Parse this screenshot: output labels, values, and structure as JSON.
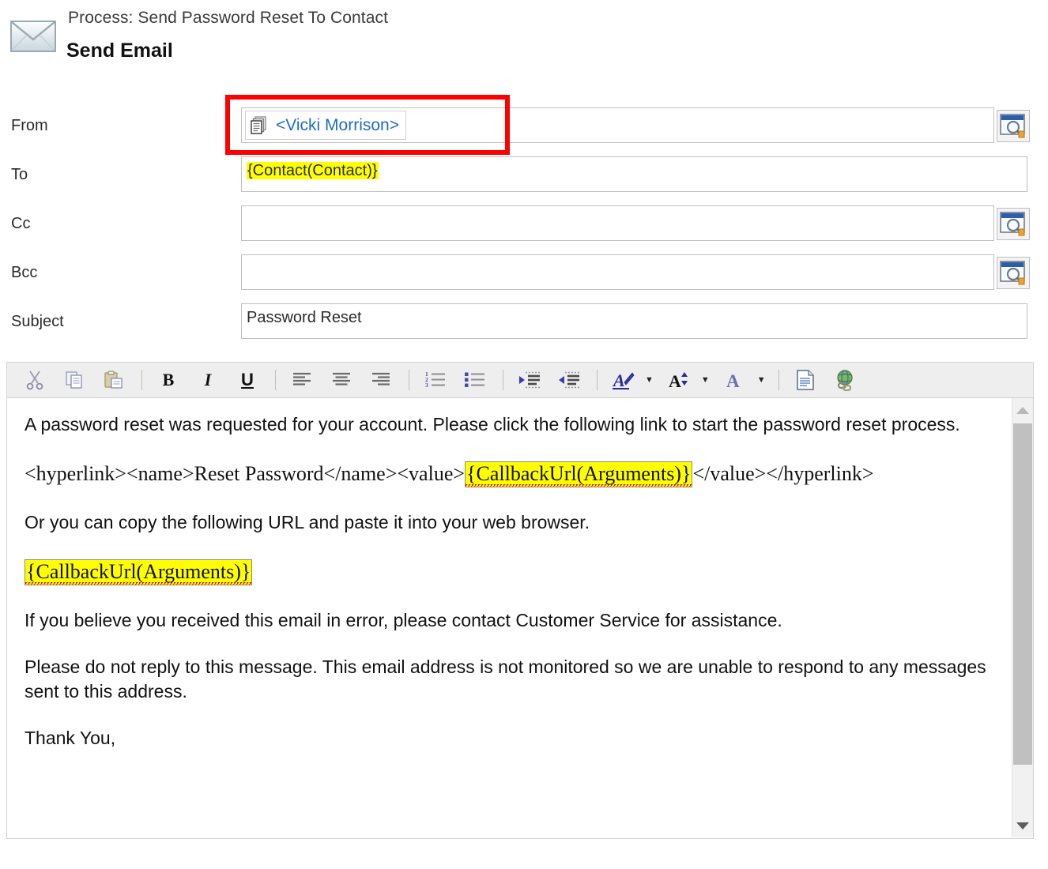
{
  "header": {
    "icon": "envelope-icon",
    "process_label": "Process: Send Password Reset To Contact",
    "title": "Send Email"
  },
  "form": {
    "from": {
      "label": "From",
      "icon": "record-stack-icon",
      "value": "<Vicki Morrison>",
      "value_color": "#1f6cc0",
      "lookup_icon": "lookup-magnifier-icon",
      "highlight_color": "#ff0000"
    },
    "to": {
      "label": "To",
      "value": "{Contact(Contact)}",
      "highlight": "#ffff00"
    },
    "cc": {
      "label": "Cc",
      "value": "",
      "lookup_icon": "lookup-magnifier-icon"
    },
    "bcc": {
      "label": "Bcc",
      "value": "",
      "lookup_icon": "lookup-magnifier-icon"
    },
    "subject": {
      "label": "Subject",
      "value": "Password Reset"
    }
  },
  "toolbar": {
    "buttons": [
      {
        "name": "cut-icon",
        "label": "Cut"
      },
      {
        "name": "copy-icon",
        "label": "Copy"
      },
      {
        "name": "paste-icon",
        "label": "Paste"
      },
      {
        "name": "bold-icon",
        "label": "B"
      },
      {
        "name": "italic-icon",
        "label": "I"
      },
      {
        "name": "underline-icon",
        "label": "U"
      },
      {
        "name": "align-left-icon",
        "label": "Align Left"
      },
      {
        "name": "align-center-icon",
        "label": "Align Center"
      },
      {
        "name": "align-right-icon",
        "label": "Align Right"
      },
      {
        "name": "numbered-list-icon",
        "label": "Numbered List"
      },
      {
        "name": "bulleted-list-icon",
        "label": "Bulleted List"
      },
      {
        "name": "increase-indent-icon",
        "label": "Increase Indent"
      },
      {
        "name": "decrease-indent-icon",
        "label": "Decrease Indent"
      },
      {
        "name": "font-family-icon",
        "label": "A"
      },
      {
        "name": "font-size-icon",
        "label": "A"
      },
      {
        "name": "font-color-icon",
        "label": "A"
      },
      {
        "name": "source-view-icon",
        "label": "Source"
      },
      {
        "name": "insert-hyperlink-icon",
        "label": "Hyperlink"
      }
    ]
  },
  "body": {
    "p1": "A password reset was requested for your account. Please click the following link to start the password reset process.",
    "p2_before": "<hyperlink><name>Reset Password</name><value>",
    "p2_token": "{CallbackUrl(Arguments)}",
    "p2_after": "</value></hyperlink>",
    "p3": "Or you can copy the following URL and paste it into your web browser.",
    "p4_token": "{CallbackUrl(Arguments)}",
    "p5": "If you believe you received this email in error, please contact Customer Service for assistance.",
    "p6": "Please do not reply to this message. This email address is not monitored so we are unable to respond to any messages sent to this address.",
    "p7": "Thank You,"
  },
  "scrollbar": {
    "up_arrow": "scroll-up-arrow-icon",
    "down_arrow": "scroll-down-arrow-icon"
  }
}
